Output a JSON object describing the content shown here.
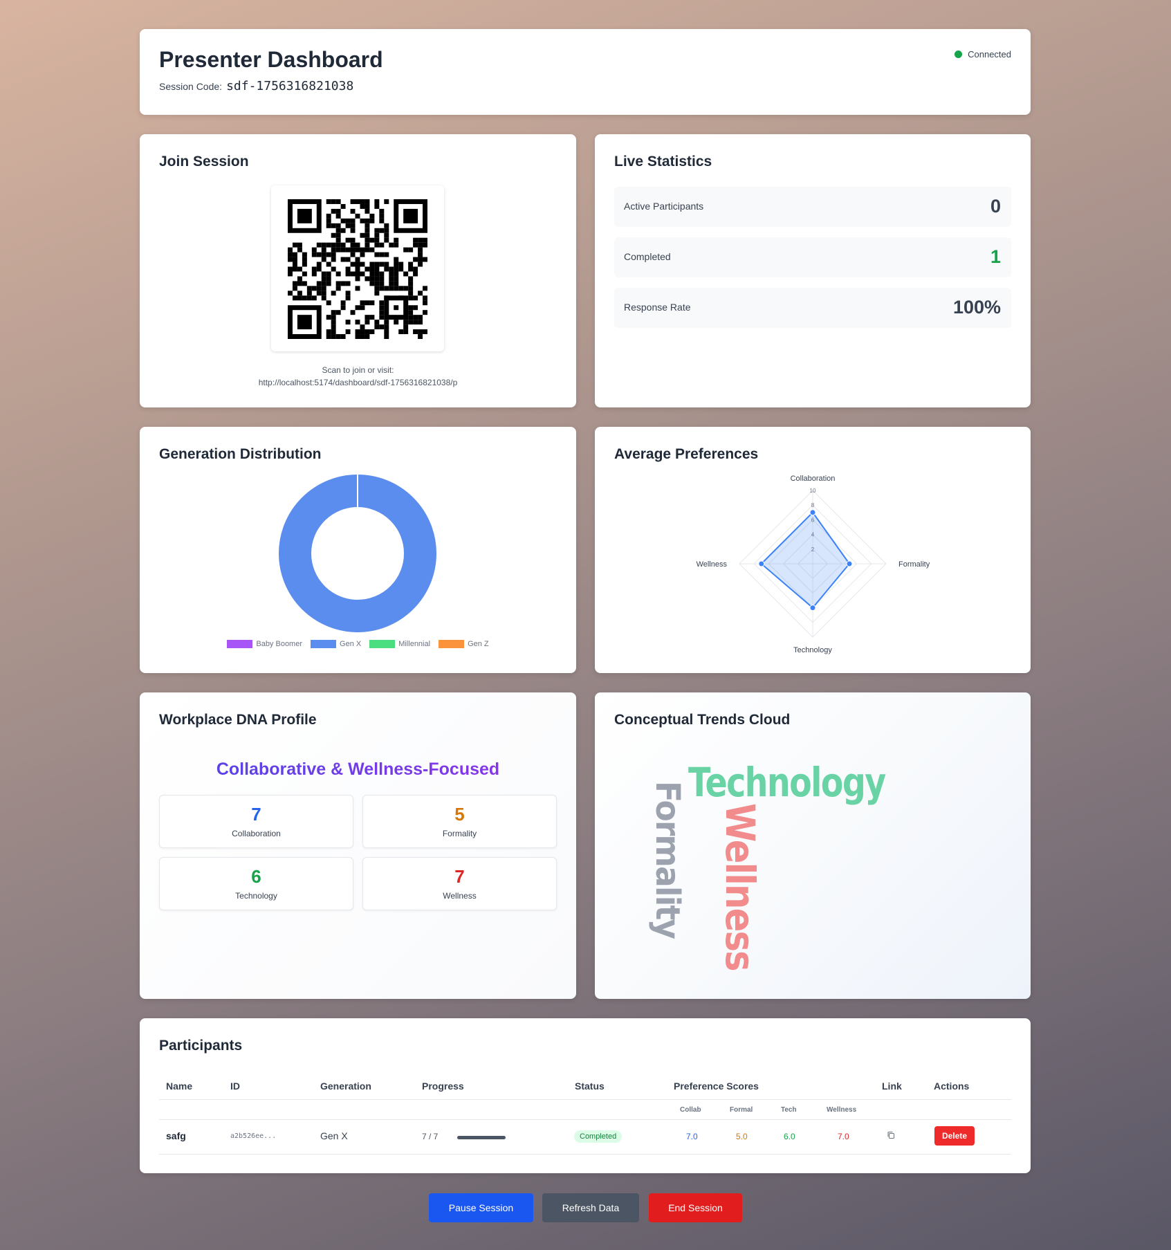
{
  "header": {
    "title": "Presenter Dashboard",
    "session_label": "Session Code:",
    "session_code": "sdf-1756316821038",
    "status": "Connected",
    "status_color": "#16a34a"
  },
  "join": {
    "title": "Join Session",
    "scan_text": "Scan to join or visit:",
    "url": "http://localhost:5174/dashboard/sdf-1756316821038/p"
  },
  "stats": {
    "title": "Live Statistics",
    "rows": [
      {
        "label": "Active Participants",
        "value": "0"
      },
      {
        "label": "Completed",
        "value": "1"
      },
      {
        "label": "Response Rate",
        "value": "100%"
      }
    ]
  },
  "generation": {
    "title": "Generation Distribution",
    "legend": [
      "Baby Boomer",
      "Gen X",
      "Millennial",
      "Gen Z"
    ]
  },
  "preferences": {
    "title": "Average Preferences"
  },
  "dna": {
    "title": "Workplace DNA Profile",
    "profile": "Collaborative & Wellness-Focused",
    "scores": [
      {
        "value": "7",
        "label": "Collaboration",
        "color": "#2563eb"
      },
      {
        "value": "5",
        "label": "Formality",
        "color": "#d97706"
      },
      {
        "value": "6",
        "label": "Technology",
        "color": "#16a34a"
      },
      {
        "value": "7",
        "label": "Wellness",
        "color": "#dc2626"
      }
    ]
  },
  "trends": {
    "title": "Conceptual Trends Cloud",
    "words": [
      {
        "text": "Technology",
        "color": "#6ad3a6"
      },
      {
        "text": "Formality",
        "color": "#9ca3af"
      },
      {
        "text": "Wellness",
        "color": "#f28b8b"
      }
    ]
  },
  "participants": {
    "title": "Participants",
    "headers": [
      "Name",
      "ID",
      "Generation",
      "Progress",
      "Status",
      "Preference Scores",
      "Link",
      "Actions"
    ],
    "sub_headers": [
      "Collab",
      "Formal",
      "Tech",
      "Wellness"
    ],
    "rows": [
      {
        "name": "safg",
        "id": "a2b526ee...",
        "generation": "Gen X",
        "progress": "7 / 7",
        "progress_fraction": 1.0,
        "status": "Completed",
        "collab": "7.0",
        "formal": "5.0",
        "tech": "6.0",
        "wellness": "7.0",
        "delete_label": "Delete"
      }
    ]
  },
  "buttons": {
    "pause": "Pause Session",
    "refresh": "Refresh Data",
    "end": "End Session"
  },
  "chart_data": [
    {
      "type": "pie",
      "title": "Generation Distribution",
      "categories": [
        "Baby Boomer",
        "Gen X",
        "Millennial",
        "Gen Z"
      ],
      "values": [
        0,
        1,
        0,
        0
      ],
      "colors": [
        "#a855f7",
        "#5b8def",
        "#4ade80",
        "#fb923c"
      ],
      "donut": true,
      "legend": "bottom"
    },
    {
      "type": "radar",
      "categories": [
        "Collaboration",
        "Formality",
        "Technology",
        "Wellness"
      ],
      "values": [
        7,
        5,
        6,
        7
      ],
      "range": [
        0,
        10
      ],
      "ticks": [
        "2",
        "4",
        "6",
        "8",
        "10"
      ]
    }
  ]
}
